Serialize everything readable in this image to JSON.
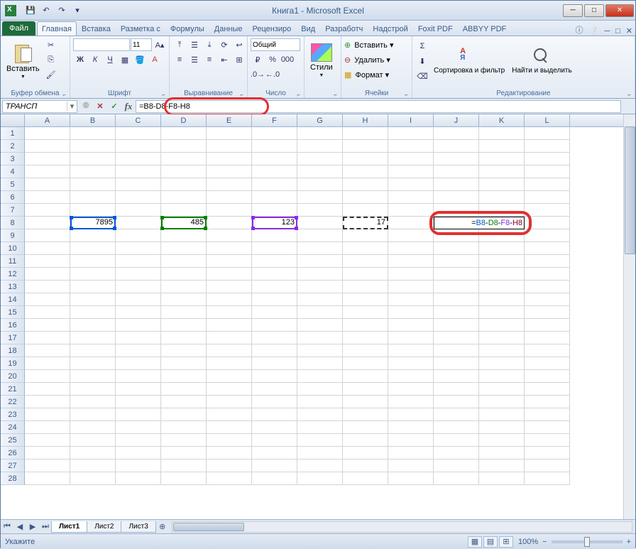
{
  "window": {
    "title": "Книга1 - Microsoft Excel"
  },
  "qat": {
    "save": "💾",
    "undo": "↶",
    "redo": "↷"
  },
  "tabs": {
    "file": "Файл",
    "home": "Главная",
    "insert": "Вставка",
    "layout": "Разметка с",
    "formulas": "Формулы",
    "data": "Данные",
    "review": "Рецензиро",
    "view": "Вид",
    "developer": "Разработч",
    "addins": "Надстрой",
    "foxit": "Foxit PDF",
    "abbyy": "ABBYY PDF"
  },
  "ribbon": {
    "clipboard": {
      "label": "Буфер обмена",
      "paste": "Вставить"
    },
    "font": {
      "label": "Шрифт",
      "name": "",
      "size": "11"
    },
    "align": {
      "label": "Выравнивание"
    },
    "number": {
      "label": "Число",
      "format": "Общий"
    },
    "styles": {
      "label": "",
      "btn": "Стили"
    },
    "cells": {
      "label": "Ячейки",
      "insert": "Вставить ▾",
      "delete": "Удалить ▾",
      "format": "Формат ▾"
    },
    "editing": {
      "label": "Редактирование",
      "sort": "Сортировка и фильтр",
      "find": "Найти и выделить"
    }
  },
  "formula": {
    "name_box": "ТРАНСП",
    "content": "=B8-D8-F8-H8"
  },
  "columns": [
    "A",
    "B",
    "C",
    "D",
    "E",
    "F",
    "G",
    "H",
    "I",
    "J",
    "K",
    "L"
  ],
  "rows": 28,
  "cell_values": {
    "B8": "7895",
    "D8": "485",
    "F8": "123",
    "H8": "17"
  },
  "edit_cell": {
    "eq": "=",
    "b": "B8",
    "m1": "-",
    "d": "D8",
    "m2": "-",
    "f": "F8",
    "m3": "-",
    "h": "H8"
  },
  "sheets": {
    "s1": "Лист1",
    "s2": "Лист2",
    "s3": "Лист3"
  },
  "status": {
    "mode": "Укажите",
    "zoom": "100%",
    "minus": "−",
    "plus": "+"
  }
}
